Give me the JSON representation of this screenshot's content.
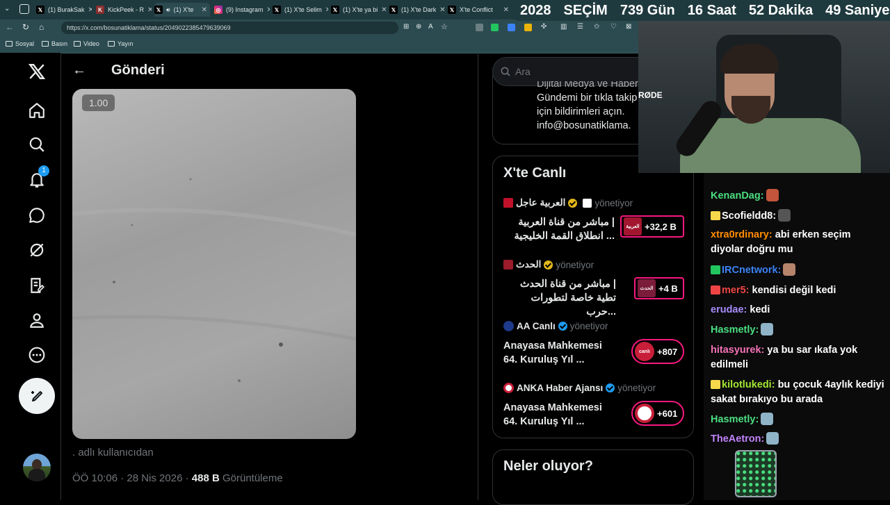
{
  "browser": {
    "tabs": [
      {
        "label": "(1) BurakSak",
        "favicon": "X"
      },
      {
        "label": "KickPeek - R",
        "favicon": "K"
      },
      {
        "label": "(1) X'te",
        "favicon": "X"
      },
      {
        "label": "(9) Instagram",
        "favicon": "I"
      },
      {
        "label": "(1) X'te Selim",
        "favicon": "X"
      },
      {
        "label": "(1) X'te ya bi",
        "favicon": "X"
      },
      {
        "label": "(1) X'te Dark",
        "favicon": "X"
      },
      {
        "label": "X'te Conflict",
        "favicon": "X"
      }
    ],
    "url": "https://x.com/bosunatiklama/status/2049022385479639069",
    "bookmarks": [
      "Sosyal",
      "Basın",
      "Video",
      "Yayın"
    ]
  },
  "countdown": {
    "year": "2028",
    "label": "SEÇİM",
    "days": "739 Gün",
    "hours": "16 Saat",
    "minutes": "52 Dakika",
    "seconds": "49 Saniye"
  },
  "nav": {
    "notification_count": "1"
  },
  "post": {
    "header_title": "Gönderi",
    "speed_badge": "1.00",
    "attribution": ". adlı kullanıcıdan",
    "timestamp": "ÖÖ 10:06 · 28 Nis 2026 ·",
    "views_count": "488 B",
    "views_label": "Görüntüleme"
  },
  "sidebar": {
    "search_placeholder": "Ara",
    "promo_lines": [
      "Dijital Medya ve Haber",
      "Gündemi bir tıkla takip",
      "için bildirimleri açın.",
      "info@bosunatiklama."
    ],
    "live": {
      "title": "X'te Canlı",
      "items": [
        {
          "name": "العربية عاجل",
          "hosting": "yönetiyor",
          "title_line1": "مباشر من قناة العربية |",
          "title_line2": "انطلاق القمة الخليجية ...",
          "count": "+32,2 B",
          "thumb_label": "العربية"
        },
        {
          "name": "الحدث",
          "hosting": "yönetiyor",
          "title_line1": "مباشر من قناة الحدث |",
          "title_line2": "تطية خاصة لتطورات حرب...",
          "count": "+4 B",
          "thumb_label": "الحدث"
        },
        {
          "name": "AA Canlı",
          "hosting": "yönetiyor",
          "title_line1": "Anayasa Mahkemesi",
          "title_line2": "64. Kuruluş Yıl ...",
          "count": "+807",
          "thumb_label": "canlı"
        },
        {
          "name": "ANKA Haber Ajansı",
          "hosting": "yönetiyor",
          "title_line1": "Anayasa Mahkemesi",
          "title_line2": "64. Kuruluş Yıl ...",
          "count": "+601",
          "thumb_label": ""
        }
      ]
    },
    "whats_happening": "Neler oluyor?"
  },
  "chat": [
    {
      "user": "KenanDag:",
      "text": "",
      "color": "#4ade80",
      "badge": ""
    },
    {
      "user": "Scofieldd8:",
      "text": "",
      "color": "#ffffff",
      "badge": "#f7d84c"
    },
    {
      "user": "xtra0rdinary:",
      "text": "abi erken seçim diyolar doğru mu",
      "color": "#ff8c00",
      "badge": ""
    },
    {
      "user": "IRCnetwork:",
      "text": "",
      "color": "#3b82f6",
      "badge": "#22c55e"
    },
    {
      "user": "mer5:",
      "text": "kendisi değil kedi",
      "color": "#ef4444",
      "badge": "#ef4444"
    },
    {
      "user": "erudae:",
      "text": "kedi",
      "color": "#a78bfa",
      "badge": ""
    },
    {
      "user": "Hasmetly:",
      "text": "",
      "color": "#4ade80",
      "badge": ""
    },
    {
      "user": "hitasyurek:",
      "text": "ya bu sar ıkafa yok edilmeli",
      "color": "#f472b6",
      "badge": ""
    },
    {
      "user": "kilotlukedi:",
      "text": "bu çocuk 4aylık kediyi sakat bırakıyo bu arada",
      "color": "#a3e635",
      "badge": "#f7d84c"
    },
    {
      "user": "Hasmetly:",
      "text": "",
      "color": "#4ade80",
      "badge": ""
    },
    {
      "user": "TheAetron:",
      "text": "",
      "color": "#c084fc",
      "badge": ""
    }
  ],
  "colors": {
    "accent": "#1d9bf0",
    "live_pink": "#f91880",
    "chrome": "#2c4b51"
  }
}
